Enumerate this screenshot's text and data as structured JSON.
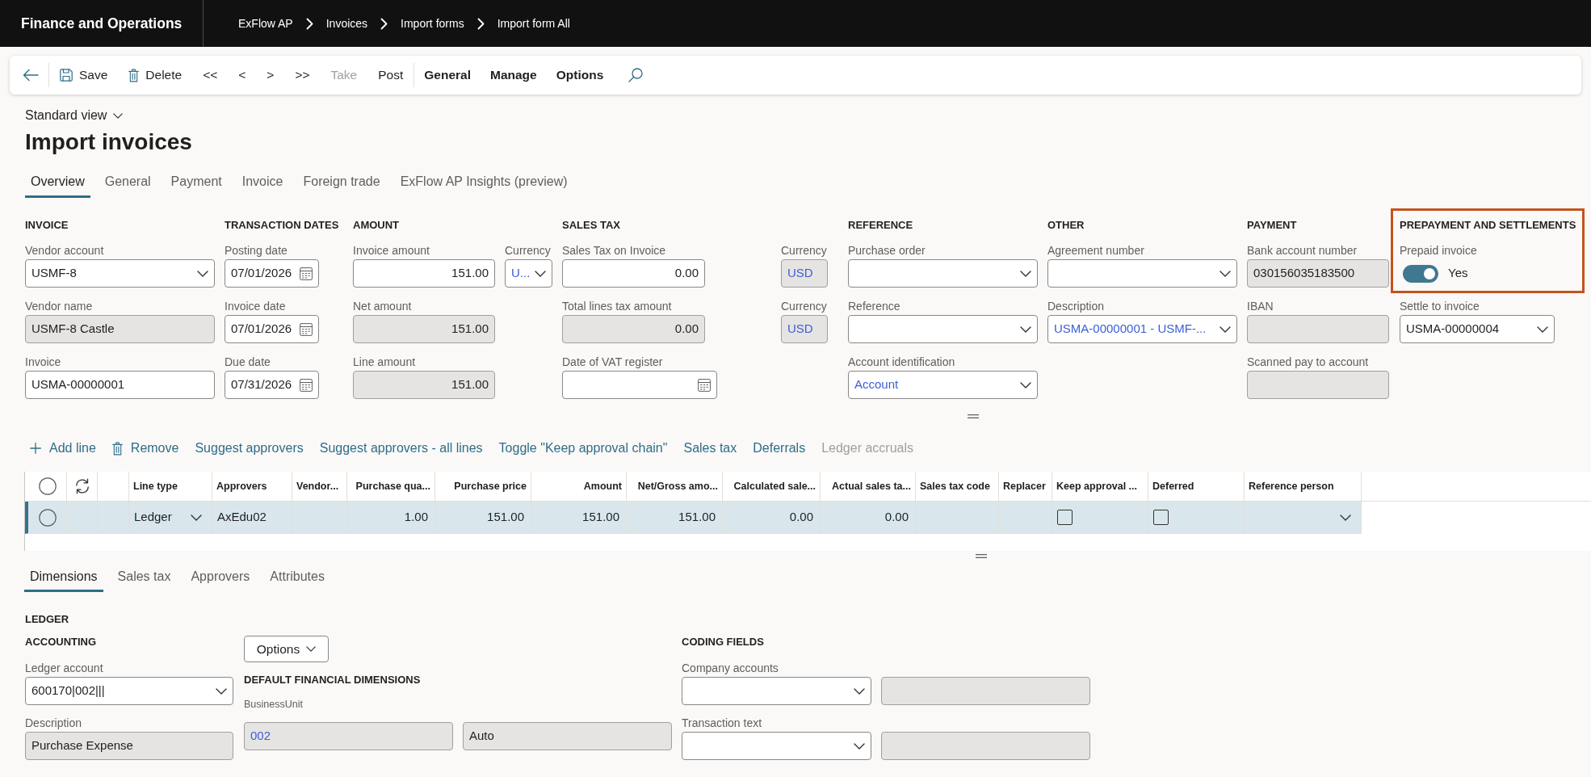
{
  "app_bar": {
    "title": "Finance and Operations",
    "breadcrumbs": [
      "ExFlow AP",
      "Invoices",
      "Import forms",
      "Import form All"
    ]
  },
  "toolbar": {
    "commands": [
      {
        "label": "Save",
        "disabled": false
      },
      {
        "label": "Delete",
        "disabled": false
      },
      {
        "label": "<<",
        "disabled": false
      },
      {
        "label": "<",
        "disabled": false
      },
      {
        "label": ">",
        "disabled": false
      },
      {
        "label": ">>",
        "disabled": false
      },
      {
        "label": "Take",
        "disabled": true
      },
      {
        "label": "Post",
        "disabled": false
      }
    ],
    "menus": [
      "General",
      "Manage",
      "Options"
    ]
  },
  "page": {
    "view": "Standard view",
    "title": "Import invoices"
  },
  "tabs": [
    {
      "label": "Overview",
      "selected": true
    },
    {
      "label": "General",
      "selected": false
    },
    {
      "label": "Payment",
      "selected": false
    },
    {
      "label": "Invoice",
      "selected": false
    },
    {
      "label": "Foreign trade",
      "selected": false
    },
    {
      "label": "ExFlow AP Insights (preview)",
      "selected": false
    }
  ],
  "field_groups": [
    {
      "heading": "INVOICE",
      "highlighted": false,
      "fields": [
        {
          "label": "Vendor account",
          "kind": "dropdown",
          "value": "USMF-8",
          "readonly": false,
          "link": false
        },
        {
          "label": "Vendor name",
          "kind": "text",
          "value": "USMF-8 Castle",
          "readonly": true,
          "link": false
        },
        {
          "label": "Invoice",
          "kind": "text",
          "value": "USMA-00000001",
          "readonly": false,
          "link": false
        }
      ]
    },
    {
      "heading": "TRANSACTION DATES",
      "highlighted": false,
      "fields": [
        {
          "label": "Posting date",
          "kind": "date",
          "value": "07/01/2026",
          "readonly": false,
          "link": false
        },
        {
          "label": "Invoice date",
          "kind": "date",
          "value": "07/01/2026",
          "readonly": false,
          "link": false
        },
        {
          "label": "Due date",
          "kind": "date",
          "value": "07/31/2026",
          "readonly": false,
          "link": false
        }
      ]
    },
    {
      "heading": "AMOUNT",
      "highlighted": false,
      "fields": [
        {
          "label": "Invoice amount",
          "kind": "amount",
          "value": "151.00",
          "readonly": false,
          "link": false
        },
        {
          "label": "Net amount",
          "kind": "amount",
          "value": "151.00",
          "readonly": true,
          "link": false
        },
        {
          "label": "Line amount",
          "kind": "amount",
          "value": "151.00",
          "readonly": true,
          "link": false
        }
      ]
    },
    {
      "highlighted": false,
      "fields": [
        {
          "label": "Currency",
          "kind": "dropdown",
          "value": "U...",
          "readonly": false,
          "link": true
        }
      ]
    },
    {
      "heading": "SALES TAX",
      "highlighted": false,
      "fields": [
        {
          "label": "Sales Tax on Invoice",
          "kind": "amount",
          "value": "0.00",
          "readonly": false,
          "link": false
        },
        {
          "label": "Total lines tax amount",
          "kind": "amount",
          "value": "0.00",
          "readonly": true,
          "link": false
        },
        {
          "label": "Date of VAT register",
          "kind": "date",
          "readonly": false
        }
      ]
    },
    {
      "highlighted": false,
      "fields": [
        {
          "label": "Currency",
          "kind": "text",
          "value": "USD",
          "readonly": true,
          "link": true
        },
        {
          "label": "Currency",
          "kind": "text",
          "value": "USD",
          "readonly": true,
          "link": true
        }
      ]
    },
    {
      "heading": "REFERENCE",
      "highlighted": false,
      "fields": [
        {
          "label": "Purchase order",
          "kind": "dropdown",
          "readonly": false
        },
        {
          "label": "Reference",
          "kind": "dropdown",
          "readonly": false
        },
        {
          "label": "Account identification",
          "kind": "dropdown",
          "value": "Account",
          "readonly": false,
          "link": true
        }
      ]
    },
    {
      "heading": "OTHER",
      "highlighted": false,
      "fields": [
        {
          "label": "Agreement number",
          "kind": "dropdown",
          "readonly": false
        },
        {
          "label": "Description",
          "kind": "dropdown",
          "value": "USMA-00000001 - USMF-...",
          "readonly": false,
          "link": true
        }
      ]
    },
    {
      "heading": "PAYMENT",
      "highlighted": false,
      "fields": [
        {
          "label": "Bank account number",
          "kind": "text",
          "value": "030156035183500",
          "readonly": true,
          "link": false
        },
        {
          "label": "IBAN",
          "kind": "text",
          "readonly": true
        },
        {
          "label": "Scanned pay to account",
          "kind": "text",
          "readonly": true
        }
      ]
    },
    {
      "heading": "PREPAYMENT AND SETTLEMENTS",
      "highlighted": true,
      "fields": [
        {
          "label": "Prepaid invoice",
          "kind": "toggle",
          "on": true,
          "value": "Yes"
        },
        {
          "label": "Settle to invoice",
          "kind": "dropdown",
          "value": "USMA-00000004",
          "readonly": false,
          "link": false
        }
      ]
    }
  ],
  "line_actions": [
    {
      "label": "Add line",
      "disabled": false
    },
    {
      "label": "Remove",
      "disabled": false
    },
    {
      "label": "Suggest approvers",
      "disabled": false
    },
    {
      "label": "Suggest approvers - all lines",
      "disabled": false
    },
    {
      "label": "Toggle \"Keep approval chain\"",
      "disabled": false
    },
    {
      "label": "Sales tax",
      "disabled": false
    },
    {
      "label": "Deferrals",
      "disabled": false
    },
    {
      "label": "Ledger accruals",
      "disabled": true
    }
  ],
  "lines_grid": {
    "columns": [
      {
        "label": "Line type",
        "kind": "dropdown"
      },
      {
        "label": "Approvers",
        "kind": "text"
      },
      {
        "label": "Vendor...",
        "kind": "text"
      },
      {
        "label": "Purchase qua...",
        "kind": "number"
      },
      {
        "label": "Purchase price",
        "kind": "number"
      },
      {
        "label": "Amount",
        "kind": "number"
      },
      {
        "label": "Net/Gross amo...",
        "kind": "number"
      },
      {
        "label": "Calculated sale...",
        "kind": "number"
      },
      {
        "label": "Actual sales ta...",
        "kind": "number"
      },
      {
        "label": "Sales tax code",
        "kind": "text"
      },
      {
        "label": "Replacer",
        "kind": "text"
      },
      {
        "label": "Keep approval ...",
        "kind": "checkbox"
      },
      {
        "label": "Deferred",
        "kind": "checkbox"
      },
      {
        "label": "Reference person",
        "kind": "dropdown"
      }
    ],
    "rows": [
      {
        "selected": true,
        "checked": false,
        "cells": [
          "Ledger",
          "AxEdu02",
          null,
          "1.00",
          "151.00",
          "151.00",
          "151.00",
          "0.00",
          "0.00",
          null,
          null,
          {
            "checked": false
          },
          {
            "checked": false
          },
          null
        ]
      }
    ]
  },
  "detail_tabs": [
    {
      "label": "Dimensions",
      "selected": true
    },
    {
      "label": "Sales tax",
      "selected": false
    },
    {
      "label": "Approvers",
      "selected": false
    },
    {
      "label": "Attributes",
      "selected": false
    }
  ],
  "dimensions": {
    "heading": "LEDGER",
    "accounting": {
      "heading": "ACCOUNTING",
      "fields": [
        {
          "label": "Ledger account",
          "kind": "dropdown",
          "value": "600170|002|||",
          "readonly": false,
          "link": false
        },
        {
          "label": "Description",
          "kind": "text",
          "value": "Purchase Expense",
          "readonly": true,
          "link": false
        }
      ]
    },
    "options_button": "Options",
    "financial_dimensions": {
      "heading": "DEFAULT FINANCIAL DIMENSIONS",
      "label": "BusinessUnit",
      "fields": [
        {
          "value": "002",
          "readonly": true,
          "link": true
        },
        {
          "value": "Auto",
          "readonly": true,
          "link": false
        }
      ]
    },
    "coding_fields": {
      "heading": "CODING FIELDS",
      "rows": [
        {
          "label": "Company accounts",
          "fields": [
            {
              "kind": "dropdown",
              "readonly": false
            },
            {
              "kind": "text",
              "readonly": true
            }
          ]
        },
        {
          "label": "Transaction text",
          "fields": [
            {
              "kind": "dropdown",
              "readonly": false
            },
            {
              "kind": "text",
              "readonly": true
            }
          ]
        }
      ]
    }
  }
}
